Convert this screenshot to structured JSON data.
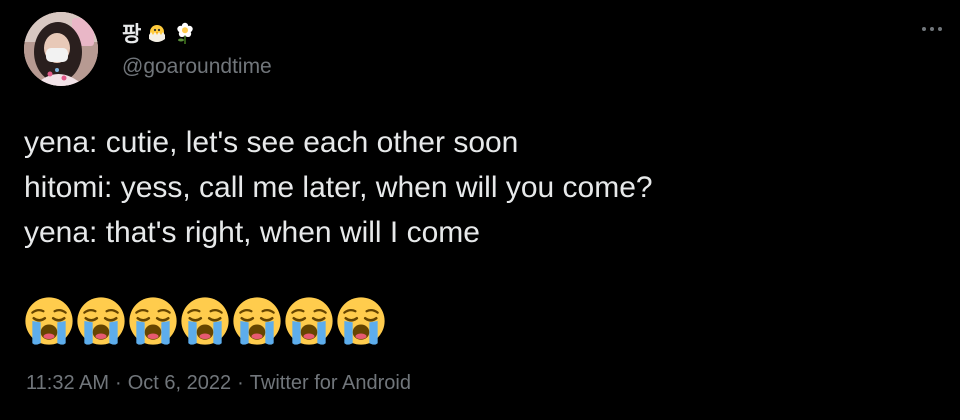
{
  "user": {
    "display_name": "팡",
    "display_name_emojis": [
      "hatching-chick-icon",
      "blossom-icon"
    ],
    "handle": "@goaroundtime"
  },
  "tweet": {
    "lines": [
      "yena: cutie, let's see each other soon",
      "hitomi: yess, call me later, when will you come?",
      "yena: that's right, when will I come"
    ],
    "emojis": [
      "loudly-crying-face-icon",
      "loudly-crying-face-icon",
      "loudly-crying-face-icon",
      "loudly-crying-face-icon",
      "loudly-crying-face-icon",
      "loudly-crying-face-icon",
      "loudly-crying-face-icon"
    ]
  },
  "meta": {
    "time": "11:32 AM",
    "separator": "·",
    "date": "Oct 6, 2022",
    "source": "Twitter for Android"
  },
  "colors": {
    "background": "#000000",
    "primary_text": "#e7e9ea",
    "secondary_text": "#71767b"
  }
}
